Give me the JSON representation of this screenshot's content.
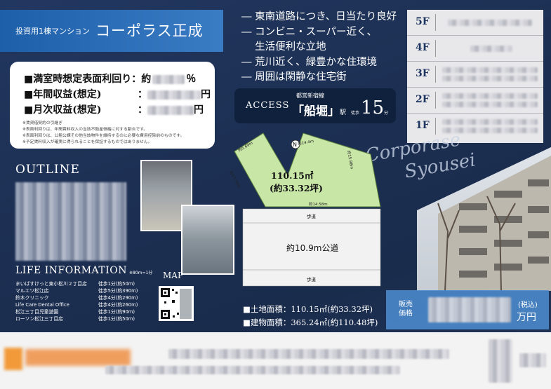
{
  "title": {
    "category": "投資用1棟マンション",
    "name": "コーポラス正成"
  },
  "features": [
    "― 東南道路につき、日当たり良好",
    "― コンビニ・スーパー近く、",
    "　 生活便利な立地",
    "― 荒川近く、緑豊かな住環境",
    "― 周囲は閑静な住宅街"
  ],
  "yield_card": {
    "rows": [
      {
        "label": "■満室時想定表面利回り",
        "sep": "：約",
        "unit": "％"
      },
      {
        "label": "■年間収益(想定)",
        "sep": "：",
        "unit": "円"
      },
      {
        "label": "■月次収益(想定)",
        "sep": "：",
        "unit": "円"
      }
    ],
    "notes": [
      "※賃貸借契約の引継ぎ",
      "※表面利回りは、年間賃料収入の当該不動産価格に対する割合です。",
      "※表面利回りは、公租公課その他当該物件を維持するのに必要な費用控除前のものです。",
      "※予定賃料収入が確実に得られることを保証するものではありません。"
    ]
  },
  "access": {
    "label": "ACCESS",
    "line": "都営新宿線",
    "station": "「船堀」",
    "eki": "駅",
    "walk": "徒歩",
    "minutes": "15",
    "fun": "分"
  },
  "floors": [
    "5F",
    "4F",
    "3F",
    "2F",
    "1F"
  ],
  "outline_title": "OUTLINE",
  "lot": {
    "area": "110.15㎡",
    "tsubo": "(約33.32坪)",
    "dims": [
      "約5.69m",
      "約14.4m",
      "約15.98m",
      "約17.35m",
      "約14.58m"
    ]
  },
  "road": {
    "walk_top": "歩道",
    "label": "約10.9m公道",
    "walk_bottom": "歩道"
  },
  "watermark": {
    "line1": "Corporase",
    "line2": "Syousei"
  },
  "life": {
    "title": "LIFE INFORMATION",
    "note": "※80m=1分",
    "items": [
      {
        "name": "まいばすけっと東小松川２丁目店",
        "dist": "徒歩1分(約50m)"
      },
      {
        "name": "マルエツ松江店",
        "dist": "徒歩5分(約390m)"
      },
      {
        "name": "鈴木クリニック",
        "dist": "徒歩4分(約290m)"
      },
      {
        "name": "Life Care Dental Office",
        "dist": "徒歩4分(約260m)"
      },
      {
        "name": "松江三丁目児童遊園",
        "dist": "徒歩1分(約90m)"
      },
      {
        "name": "ローソン松江三丁目店",
        "dist": "徒歩1分(約50m)"
      }
    ]
  },
  "map_title": "MAP",
  "area_data": {
    "land": "■土地面積：110.15㎡(約33.32坪)",
    "building": "■建物面積：365.24㎡(約110.48坪)"
  },
  "price": {
    "label1": "販売",
    "label2": "価格",
    "tax": "(税込)",
    "unit": "万円"
  },
  "colors": {
    "background": "#1d2f4e",
    "title_bar": "#2d6db8",
    "lot": "#c8e6a6",
    "price_box": "#4c8bce"
  }
}
